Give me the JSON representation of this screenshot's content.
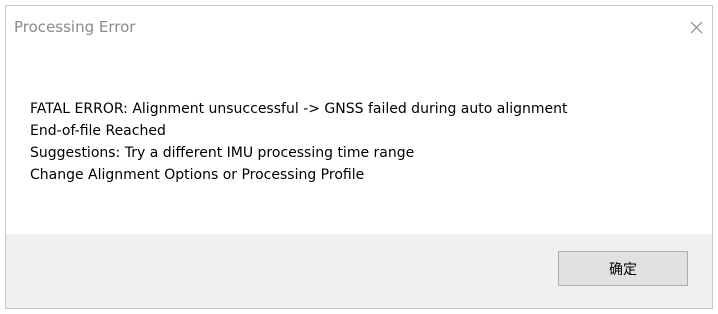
{
  "window": {
    "title": "Processing Error",
    "close_icon": "close-icon"
  },
  "message": {
    "lines": [
      "FATAL ERROR: Alignment unsuccessful -> GNSS failed during auto alignment",
      "End-of-file Reached",
      "Suggestions: Try a different IMU processing time range",
      "Change Alignment Options or Processing Profile"
    ]
  },
  "footer": {
    "ok_label": "确定"
  },
  "colors": {
    "title_text": "#8a8a8a",
    "footer_bg": "#f0f0f0",
    "button_bg": "#e1e1e1",
    "button_border": "#adadad"
  }
}
